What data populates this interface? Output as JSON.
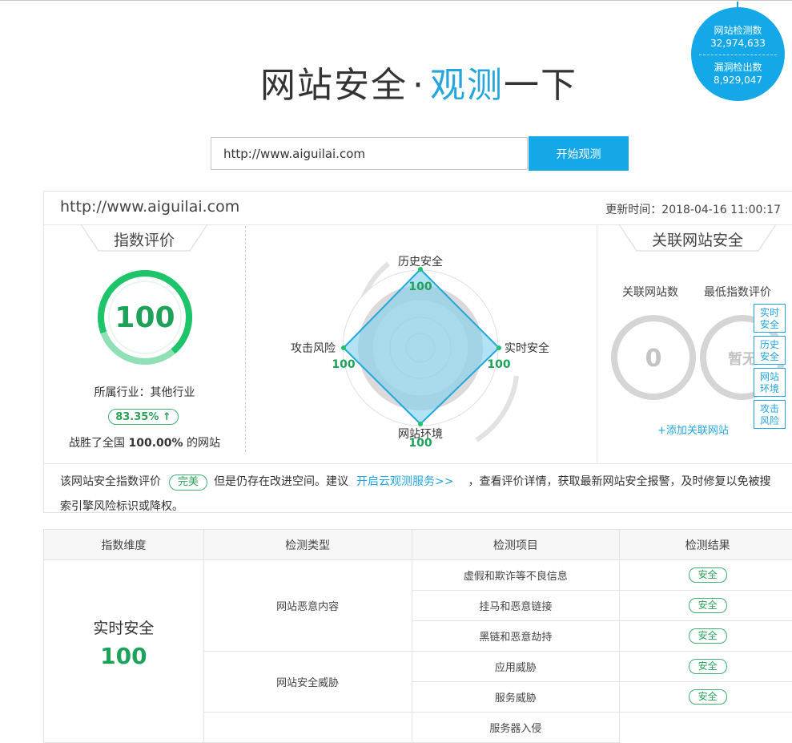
{
  "stats": {
    "label1": "网站检测数",
    "value1": "32,974,633",
    "label2": "漏洞检出数",
    "value2": "8,929,047"
  },
  "hero": {
    "part1": "网站安全",
    "dot": "·",
    "accent": "观测",
    "part2": "一下"
  },
  "search": {
    "value": "http://www.aiguilai.com",
    "button": "开始观测"
  },
  "result": {
    "url": "http://www.aiguilai.com",
    "update_label": "更新时间：",
    "update_time": "2018-04-16 11:00:17"
  },
  "index": {
    "title": "指数评价",
    "score": "100",
    "industry": "所属行业：其他行业",
    "percent": "83.35% ↑",
    "beat_prefix": "战胜了全国",
    "beat_value": "100.00%",
    "beat_suffix": "的网站"
  },
  "radar": {
    "axes": [
      {
        "label": "历史安全",
        "value": "100"
      },
      {
        "label": "实时安全",
        "value": "100"
      },
      {
        "label": "网站环境",
        "value": "100"
      },
      {
        "label": "攻击风险",
        "value": "100"
      }
    ]
  },
  "related": {
    "title": "关联网站安全",
    "count_label": "关联网站数",
    "min_label": "最低指数评价",
    "count_value": "0",
    "min_value": "暂无",
    "add": "+添加关联网站",
    "tabs": [
      {
        "line1": "实时",
        "line2": "安全"
      },
      {
        "line1": "历史",
        "line2": "安全"
      },
      {
        "line1": "网站",
        "line2": "环境"
      },
      {
        "line1": "攻击",
        "line2": "风险"
      }
    ]
  },
  "advice": {
    "prefix": "该网站安全指数评价",
    "badge": "完美",
    "middle": "但是仍存在改进空间。建议",
    "link": "开启云观测服务>>",
    "suffix": "，查看评价详情，获取最新网站安全报警，及时修复以免被搜索引擎风险标识或降权。"
  },
  "table": {
    "headers": [
      "指数维度",
      "检测类型",
      "检测项目",
      "检测结果"
    ],
    "dimension": "实时安全",
    "dimension_score": "100",
    "type1": "网站恶意内容",
    "type2": "网站安全威胁",
    "items": [
      "虚假和欺诈等不良信息",
      "挂马和恶意链接",
      "黑链和恶意劫持",
      "应用威胁",
      "服务威胁",
      "服务器入侵"
    ],
    "safe": "安全"
  },
  "colors": {
    "accent": "#14a8e8",
    "green": "#1ea25a"
  }
}
